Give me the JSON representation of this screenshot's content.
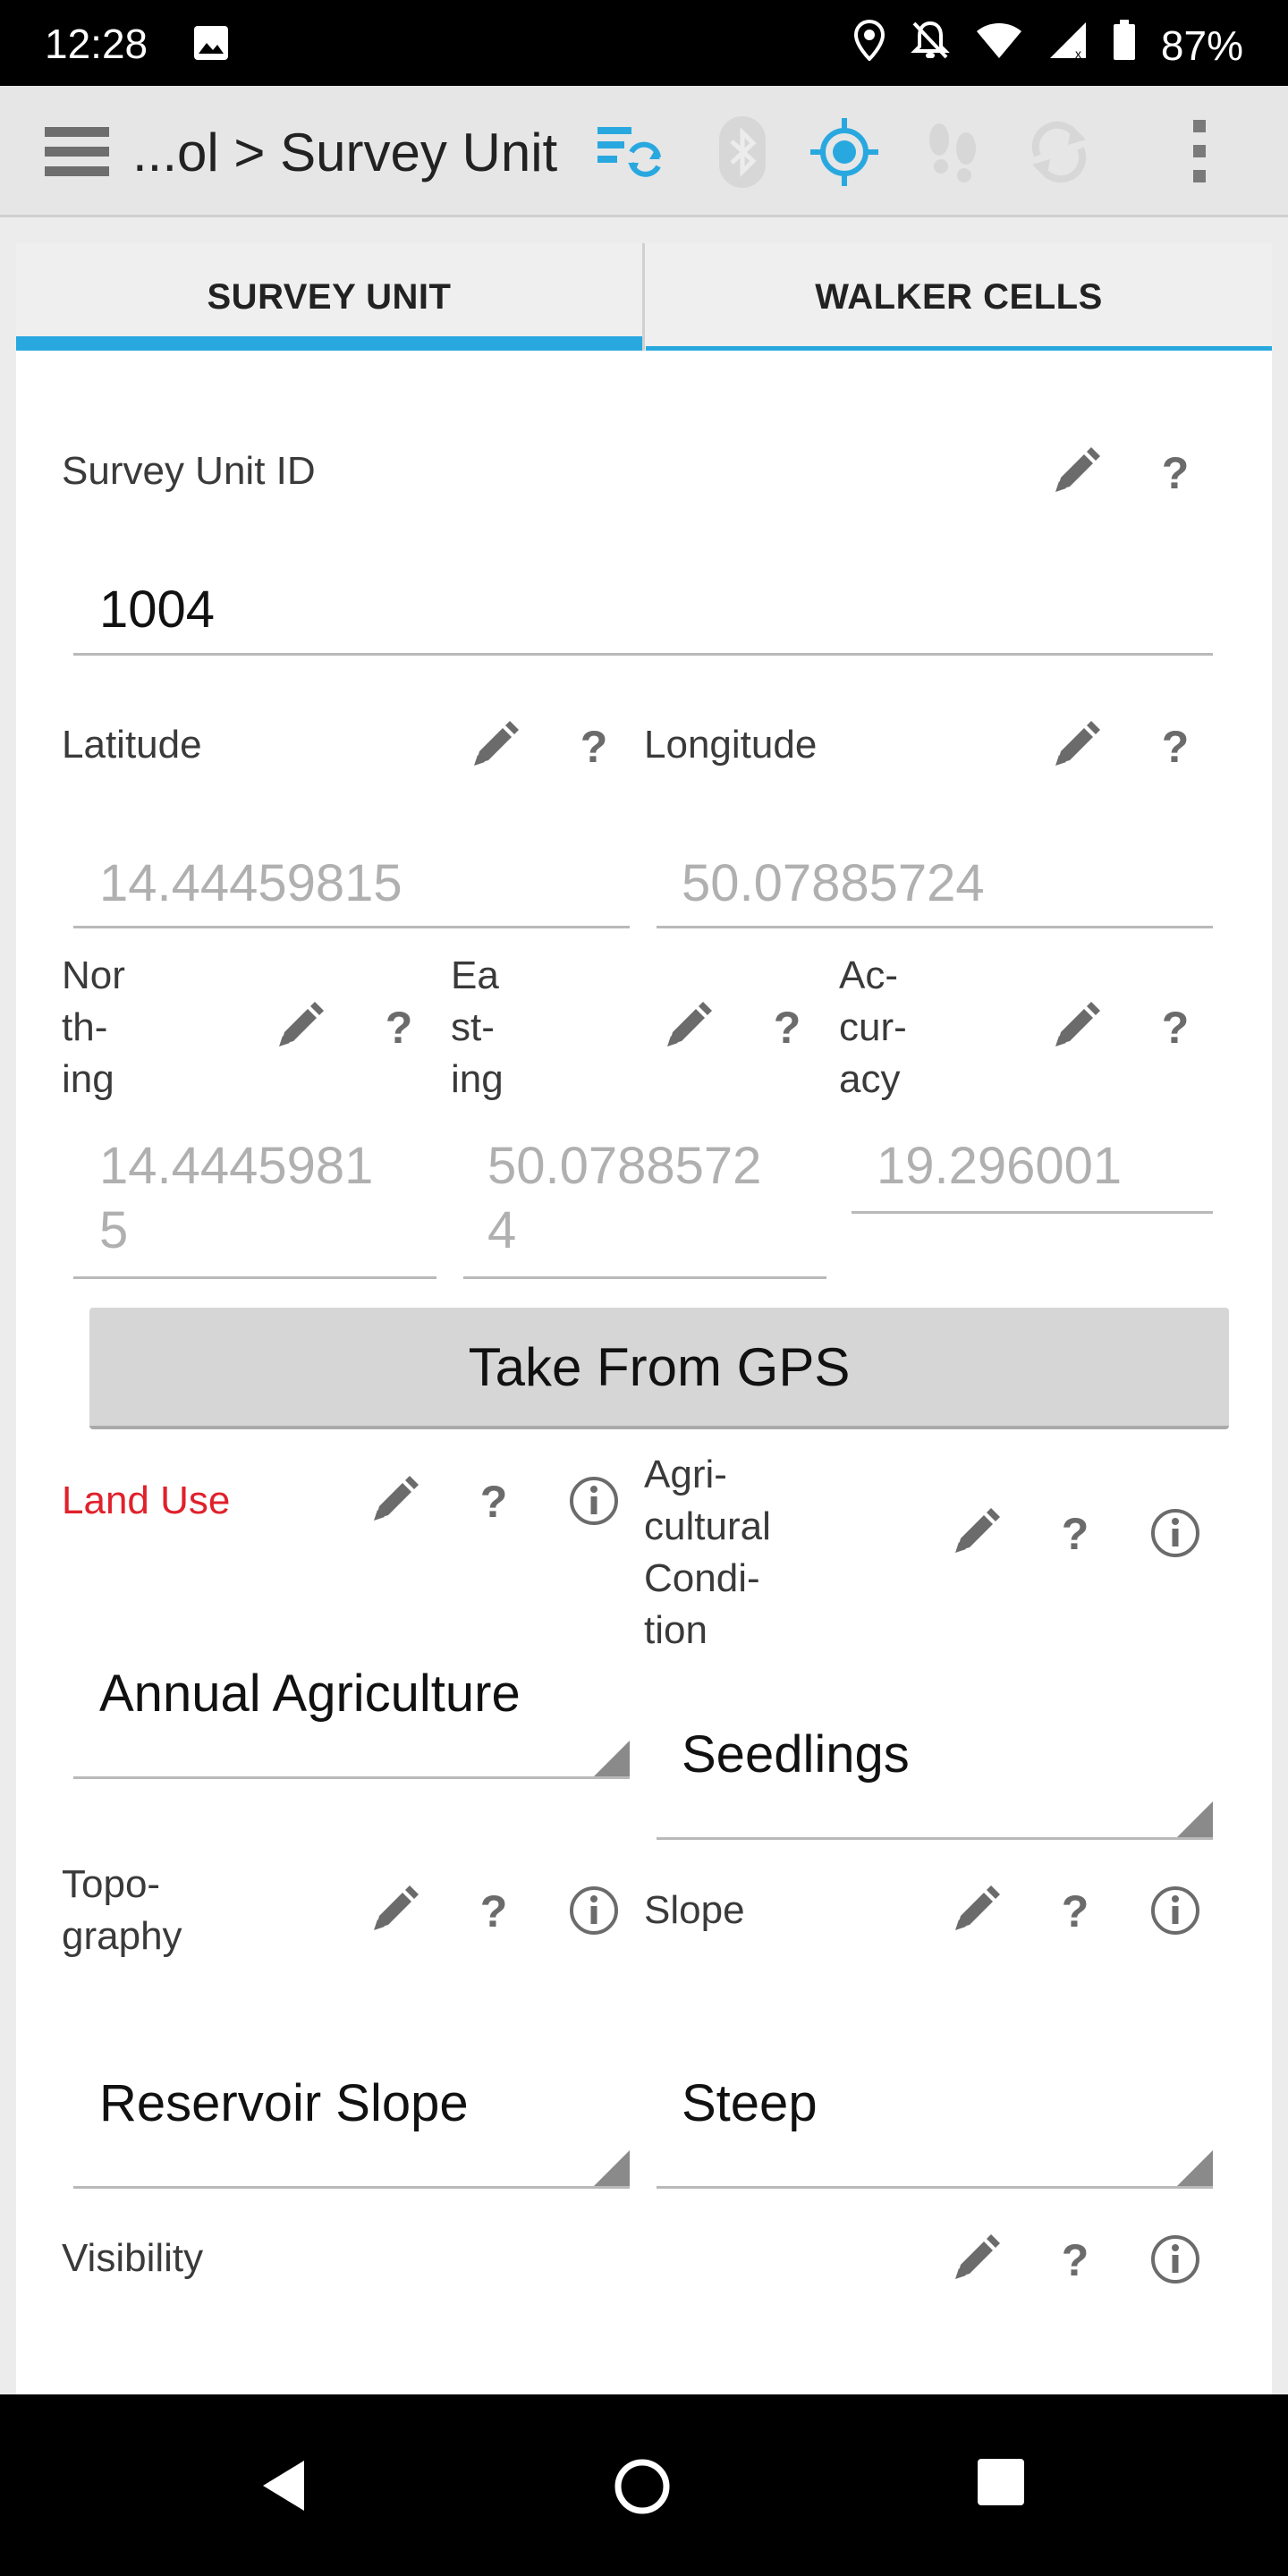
{
  "status_bar": {
    "time": "12:28",
    "battery": "87%",
    "icons": [
      "image-icon",
      "location-icon",
      "notifications-off-icon",
      "wifi-icon",
      "signal-icon",
      "battery-icon"
    ]
  },
  "app_bar": {
    "title": "...ol > Survey Unit",
    "icons": [
      "menu-icon",
      "sync-list-icon",
      "bluetooth-icon",
      "gps-target-icon",
      "footsteps-icon",
      "refresh-icon",
      "overflow-menu-icon"
    ],
    "accent_color": "#29a8e0"
  },
  "tabs": [
    {
      "label": "SURVEY UNIT",
      "active": true
    },
    {
      "label": "WALKER CELLS",
      "active": false
    }
  ],
  "form": {
    "survey_unit_id": {
      "label": "Survey Unit ID",
      "value": "1004"
    },
    "latitude": {
      "label": "Latitude",
      "value": "14.44459815"
    },
    "longitude": {
      "label": "Longitude",
      "value": "50.07885724"
    },
    "northing": {
      "label_lines": [
        "Nor",
        "th-",
        "ing"
      ],
      "value_lines": [
        "14.4445981",
        "5"
      ]
    },
    "easting": {
      "label_lines": [
        "Ea",
        "st-",
        "ing"
      ],
      "value_lines": [
        "50.0788572",
        "4"
      ]
    },
    "accuracy": {
      "label_lines": [
        "Ac-",
        "cur-",
        "acy"
      ],
      "value": "19.296001"
    },
    "gps_button": "Take From GPS",
    "land_use": {
      "label": "Land Use",
      "value": "Annual Agriculture",
      "label_color": "#e0212b"
    },
    "agricultural_condition": {
      "label_lines": [
        "Agri-",
        "cultural",
        "Condi-",
        "tion"
      ],
      "value": "Seedlings"
    },
    "topography": {
      "label_lines": [
        "Topo-",
        "graphy"
      ],
      "value": "Reservoir Slope"
    },
    "slope": {
      "label": "Slope",
      "value": "Steep"
    },
    "visibility": {
      "label": "Visibility"
    }
  },
  "nav_bar": {
    "icons": [
      "back-icon",
      "home-icon",
      "recents-icon"
    ]
  }
}
